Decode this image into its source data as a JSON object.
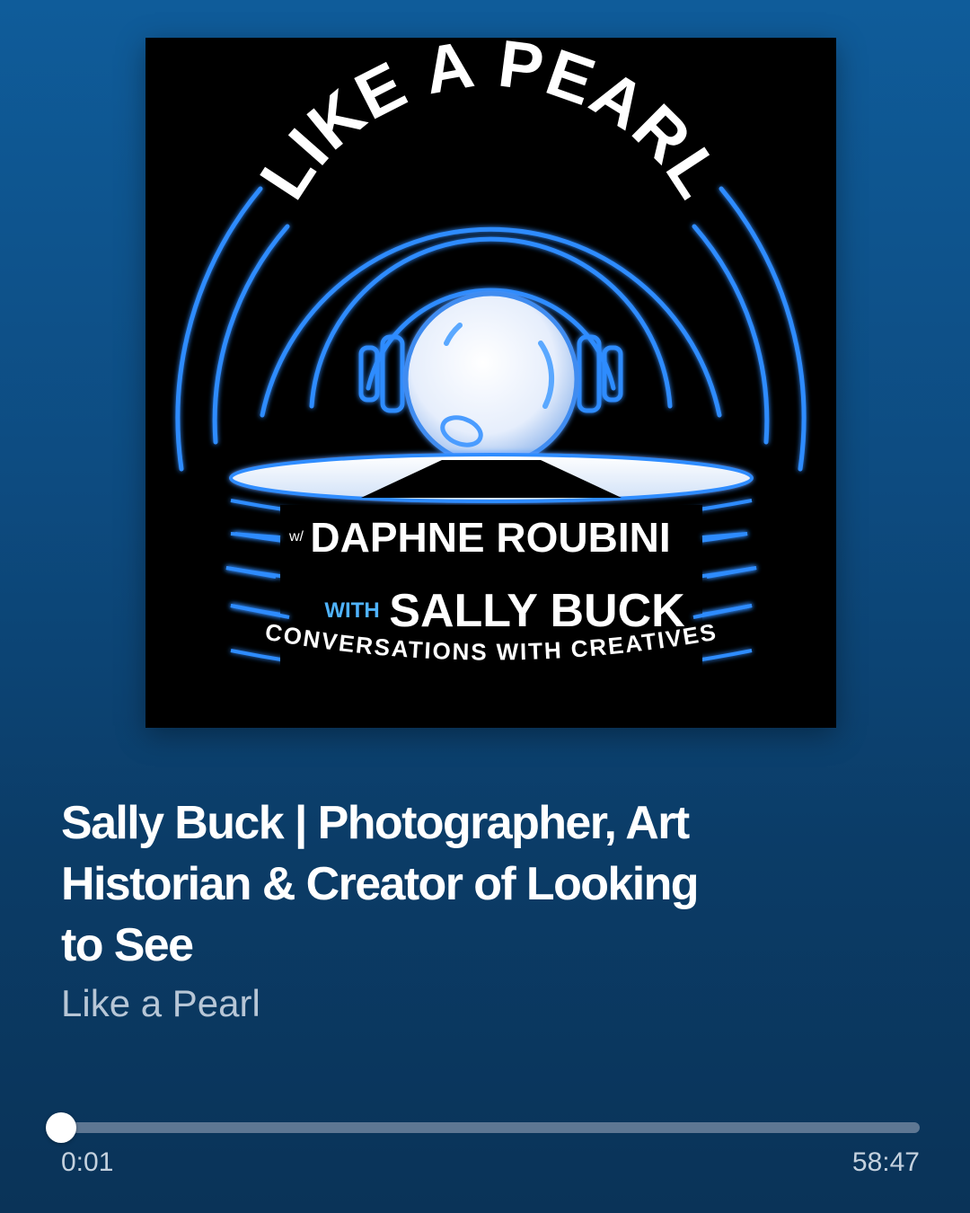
{
  "artwork": {
    "title_arc": "LIKE A PEARL",
    "host_prefix": "w/",
    "host": "DAPHNE ROUBINI",
    "guest_prefix": "WITH",
    "guest": "SALLY BUCK",
    "tagline": "CONVERSATIONS WITH CREATIVES"
  },
  "episode": {
    "title": "Sally Buck | Photographer, Art Historian & Creator of Looking to See",
    "show": "Like a Pearl"
  },
  "playback": {
    "elapsed": "0:01",
    "total": "58:47",
    "progress_fraction": 0.0003
  },
  "colors": {
    "background_top": "#0f5c9a",
    "background_bottom": "#0a3358",
    "neon_blue": "#2f8cff",
    "track": "#5e7793"
  }
}
